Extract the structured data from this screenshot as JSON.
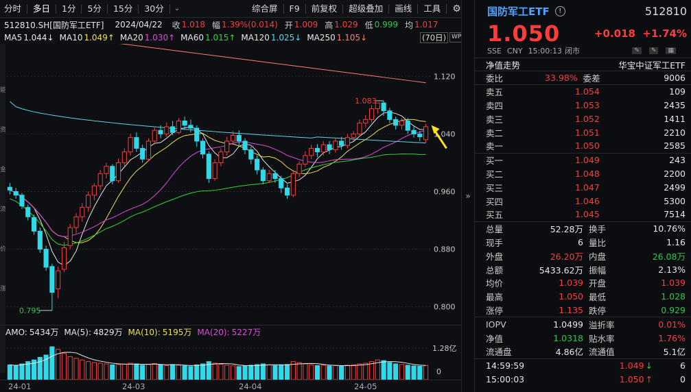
{
  "toolbar": {
    "tabs_left": [
      "分时",
      "多日",
      "1分",
      "5分",
      "15分",
      "30分"
    ],
    "selected_left": "多日",
    "tabs_right": [
      "综合屏",
      "F9",
      "前复权",
      "超级叠加",
      "画线",
      "工具"
    ]
  },
  "info": {
    "code_name": "512810.SH[国防军工ETF]",
    "date": "2024/04/22",
    "close_label": "收",
    "close": "1.018",
    "amp_label": "幅",
    "amp": "1.39%(0.014)",
    "open_label": "开",
    "open": "1.009",
    "high_label": "高",
    "high": "1.029",
    "low_label": "低",
    "low": "0.999",
    "avg_label": "均",
    "avg": "1.017"
  },
  "ma": [
    {
      "label": "MA5",
      "value": "1.044↓",
      "color": "#e8e8e8"
    },
    {
      "label": "MA10",
      "value": "1.049↑",
      "color": "#f0e14a"
    },
    {
      "label": "MA20",
      "value": "1.030↑",
      "color": "#e04ae0"
    },
    {
      "label": "MA60",
      "value": "1.015↑",
      "color": "#36d636"
    },
    {
      "label": "MA120",
      "value": "1.025↓",
      "color": "#5cd8e8"
    },
    {
      "label": "MA250",
      "value": "1.105↓",
      "color": "#ff7a7a"
    }
  ],
  "period_badge": "(70日)",
  "side_labels": [
    "能",
    "资",
    "金",
    "流",
    "价",
    "涨"
  ],
  "chart_data": {
    "type": "candlestick",
    "y_ticks": [
      "1.120",
      "1.040",
      "0.960",
      "0.880",
      "0.800"
    ],
    "ylim": [
      0.775,
      1.165
    ],
    "max_label": "1.083",
    "min_label": "0.795",
    "x_labels": [
      "24-01",
      "24-03",
      "24-04",
      "24-05"
    ],
    "candles": [
      [
        0.966,
        0.962,
        0.972,
        0.956
      ],
      [
        0.96,
        0.955,
        0.965,
        0.95
      ],
      [
        0.955,
        0.94,
        0.958,
        0.936
      ],
      [
        0.938,
        0.925,
        0.942,
        0.92
      ],
      [
        0.924,
        0.905,
        0.928,
        0.9
      ],
      [
        0.905,
        0.88,
        0.91,
        0.875
      ],
      [
        0.88,
        0.855,
        0.885,
        0.85
      ],
      [
        0.856,
        0.82,
        0.86,
        0.795
      ],
      [
        0.825,
        0.85,
        0.856,
        0.812
      ],
      [
        0.852,
        0.882,
        0.89,
        0.848
      ],
      [
        0.885,
        0.91,
        0.915,
        0.88
      ],
      [
        0.91,
        0.925,
        0.93,
        0.902
      ],
      [
        0.925,
        0.938,
        0.944,
        0.918
      ],
      [
        0.938,
        0.955,
        0.96,
        0.932
      ],
      [
        0.955,
        0.968,
        0.972,
        0.948
      ],
      [
        0.968,
        0.985,
        0.99,
        0.962
      ],
      [
        0.985,
        0.995,
        1.0,
        0.978
      ],
      [
        0.995,
        0.975,
        0.998,
        0.97
      ],
      [
        0.975,
        1.0,
        1.006,
        0.972
      ],
      [
        1.0,
        1.015,
        1.02,
        0.995
      ],
      [
        1.015,
        1.035,
        1.04,
        1.01
      ],
      [
        1.035,
        1.02,
        1.042,
        1.015
      ],
      [
        1.02,
        1.005,
        1.025,
        1.0
      ],
      [
        1.005,
        1.03,
        1.034,
        1.002
      ],
      [
        1.03,
        1.045,
        1.05,
        1.025
      ],
      [
        1.045,
        1.04,
        1.052,
        1.034
      ],
      [
        1.04,
        1.05,
        1.056,
        1.036
      ],
      [
        1.05,
        1.042,
        1.058,
        1.038
      ],
      [
        1.042,
        1.058,
        1.062,
        1.04
      ],
      [
        1.058,
        1.052,
        1.064,
        1.046
      ],
      [
        1.052,
        1.048,
        1.06,
        1.042
      ],
      [
        1.048,
        1.03,
        1.052,
        1.022
      ],
      [
        1.03,
        1.012,
        1.034,
        1.006
      ],
      [
        1.012,
        0.978,
        1.016,
        0.972
      ],
      [
        0.978,
        1.0,
        1.005,
        0.975
      ],
      [
        1.0,
        1.015,
        1.02,
        0.995
      ],
      [
        1.015,
        1.03,
        1.036,
        1.01
      ],
      [
        1.03,
        1.038,
        1.044,
        1.026
      ],
      [
        1.038,
        1.03,
        1.045,
        1.024
      ],
      [
        1.03,
        1.018,
        1.034,
        1.012
      ],
      [
        1.018,
        1.005,
        1.022,
        0.998
      ],
      [
        1.005,
        0.99,
        1.01,
        0.984
      ],
      [
        0.99,
        0.975,
        0.994,
        0.97
      ],
      [
        0.975,
        0.985,
        0.99,
        0.972
      ],
      [
        0.985,
        0.978,
        0.99,
        0.972
      ],
      [
        0.978,
        0.965,
        0.982,
        0.958
      ],
      [
        0.965,
        0.955,
        0.97,
        0.95
      ],
      [
        0.955,
        0.985,
        0.99,
        0.952
      ],
      [
        0.985,
        0.998,
        1.002,
        0.98
      ],
      [
        0.998,
        1.01,
        1.016,
        0.994
      ],
      [
        1.01,
        1.02,
        1.025,
        1.005
      ],
      [
        1.02,
        1.015,
        1.026,
        1.008
      ],
      [
        1.015,
        1.025,
        1.03,
        1.01
      ],
      [
        1.025,
        1.018,
        1.03,
        1.012
      ],
      [
        1.018,
        1.03,
        1.034,
        1.014
      ],
      [
        1.03,
        1.024,
        1.036,
        1.018
      ],
      [
        1.024,
        1.035,
        1.04,
        1.02
      ],
      [
        1.035,
        1.04,
        1.044,
        1.03
      ],
      [
        1.04,
        1.055,
        1.06,
        1.036
      ],
      [
        1.055,
        1.06,
        1.066,
        1.05
      ],
      [
        1.06,
        1.075,
        1.08,
        1.056
      ],
      [
        1.075,
        1.083,
        1.083,
        1.068
      ],
      [
        1.083,
        1.072,
        1.086,
        1.065
      ],
      [
        1.072,
        1.06,
        1.076,
        1.055
      ],
      [
        1.06,
        1.052,
        1.064,
        1.046
      ],
      [
        1.052,
        1.058,
        1.062,
        1.046
      ],
      [
        1.058,
        1.045,
        1.062,
        1.04
      ],
      [
        1.045,
        1.04,
        1.05,
        1.035
      ],
      [
        1.04,
        1.036,
        1.044,
        1.03
      ],
      [
        1.032,
        1.05,
        1.054,
        1.028
      ]
    ]
  },
  "volume": {
    "amo_label": "AMO:",
    "amo": "5434万",
    "ma5_label": "MA(5):",
    "ma5": "4829万",
    "ma10_label": "MA(10):",
    "ma10": "5195万",
    "ma20_label": "MA(20):",
    "ma20": "5227万",
    "axis_top": "1.28亿",
    "axis_zero": "0",
    "bars": [
      0.45,
      0.42,
      0.48,
      0.55,
      0.6,
      0.68,
      0.75,
      1.0,
      0.92,
      0.8,
      0.7,
      0.65,
      0.6,
      0.55,
      0.52,
      0.5,
      0.48,
      0.45,
      0.46,
      0.47,
      0.5,
      0.48,
      0.44,
      0.46,
      0.49,
      0.45,
      0.43,
      0.46,
      0.44,
      0.42,
      0.4,
      0.45,
      0.48,
      0.55,
      0.5,
      0.47,
      0.44,
      0.42,
      0.4,
      0.42,
      0.44,
      0.46,
      0.48,
      0.45,
      0.43,
      0.44,
      0.46,
      0.55,
      0.52,
      0.48,
      0.45,
      0.43,
      0.44,
      0.42,
      0.43,
      0.41,
      0.44,
      0.45,
      0.48,
      0.5,
      0.55,
      0.6,
      0.58,
      0.52,
      0.48,
      0.46,
      0.44,
      0.42,
      0.41,
      0.43
    ]
  },
  "quote": {
    "name": "国防军工ETF",
    "code": "512810",
    "price": "1.050",
    "change": "+0.018",
    "pct": "+1.74%",
    "exchange": "SSE",
    "currency": "CNY",
    "time": "15:00:13",
    "status": "闭市",
    "nav_label": "净值走势",
    "index_name": "华宝中证军工ETF",
    "weibi_label": "委比",
    "weibi": "33.98%",
    "weicha_label": "委差",
    "weicha": "9006",
    "asks": [
      {
        "label": "卖五",
        "price": "1.054",
        "vol": "109"
      },
      {
        "label": "卖四",
        "price": "1.053",
        "vol": "2435"
      },
      {
        "label": "卖三",
        "price": "1.052",
        "vol": "1411"
      },
      {
        "label": "卖二",
        "price": "1.051",
        "vol": "2210"
      },
      {
        "label": "卖一",
        "price": "1.050",
        "vol": "2585"
      }
    ],
    "bids": [
      {
        "label": "买一",
        "price": "1.049",
        "vol": "243"
      },
      {
        "label": "买二",
        "price": "1.048",
        "vol": "2200"
      },
      {
        "label": "买三",
        "price": "1.047",
        "vol": "2499"
      },
      {
        "label": "买四",
        "price": "1.046",
        "vol": "5300"
      },
      {
        "label": "买五",
        "price": "1.045",
        "vol": "7514"
      }
    ],
    "stats": [
      {
        "l1": "总量",
        "v1": "52.28万",
        "c1": "wht",
        "l2": "换手",
        "v2": "10.76%",
        "c2": "wht"
      },
      {
        "l1": "现手",
        "v1": "6",
        "c1": "wht",
        "l2": "量比",
        "v2": "1.16",
        "c2": "wht"
      },
      {
        "l1": "外盘",
        "v1": "26.20万",
        "c1": "red",
        "l2": "内盘",
        "v2": "26.08万",
        "c2": "grn"
      },
      {
        "l1": "总额",
        "v1": "5433.62万",
        "c1": "wht",
        "l2": "振幅",
        "v2": "2.13%",
        "c2": "wht"
      },
      {
        "l1": "均价",
        "v1": "1.039",
        "c1": "red",
        "l2": "开盘",
        "v2": "1.039",
        "c2": "red"
      },
      {
        "l1": "最高",
        "v1": "1.050",
        "c1": "red",
        "l2": "最低",
        "v2": "1.028",
        "c2": "grn"
      },
      {
        "l1": "涨停",
        "v1": "1.135",
        "c1": "red",
        "l2": "跌停",
        "v2": "0.929",
        "c2": "grn"
      }
    ],
    "stats2": [
      {
        "l1": "IOPV",
        "v1": "1.0499",
        "c1": "wht",
        "l2": "溢折率",
        "v2": "0.01%",
        "c2": "red"
      },
      {
        "l1": "净值",
        "v1": "1.0318",
        "c1": "grn",
        "l2": "贴水率",
        "v2": "1.76%",
        "c2": "red"
      },
      {
        "l1": "流通盘",
        "v1": "4.86亿",
        "c1": "wht",
        "l2": "流通值",
        "v2": "5.1亿",
        "c2": "wht"
      }
    ],
    "ticks": [
      {
        "time": "14:59:59",
        "price": "1.049",
        "arrow": "↓",
        "arrow_color": "#26c94a",
        "vol": "6"
      },
      {
        "time": "15:00:03",
        "price": "1.050",
        "arrow": "↑",
        "arrow_color": "#ff3b3b",
        "vol": "0"
      }
    ]
  }
}
